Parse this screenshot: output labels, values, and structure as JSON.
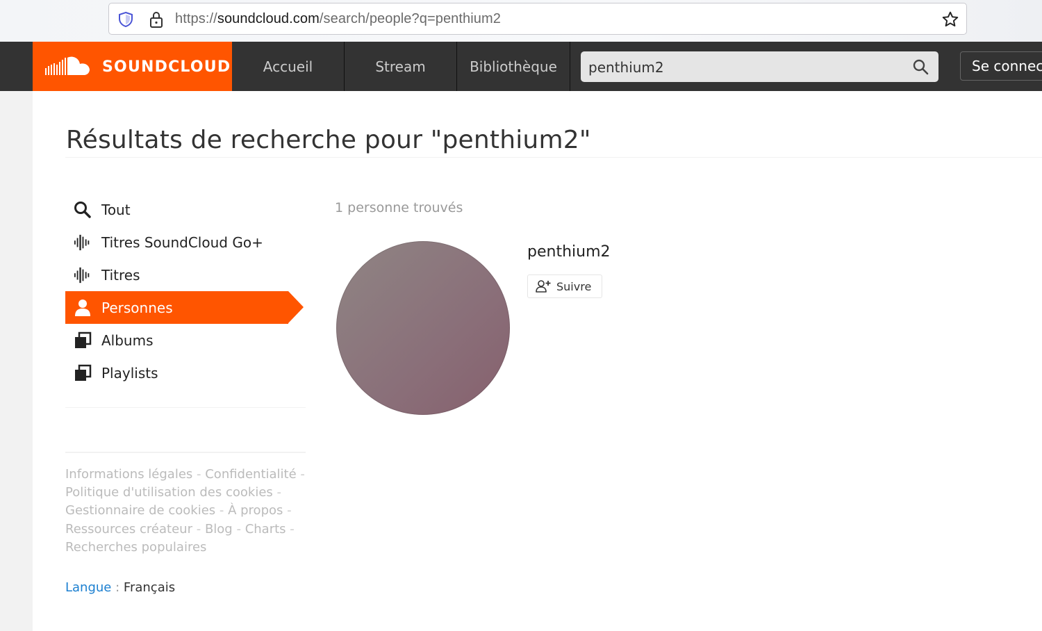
{
  "browser": {
    "url_prefix": "https://",
    "url_domain": "soundcloud.com",
    "url_path": "/search/people?q=penthium2"
  },
  "header": {
    "brand": "SOUNDCLOUD",
    "nav": [
      "Accueil",
      "Stream",
      "Bibliothèque"
    ],
    "search_value": "penthium2",
    "signin_label": "Se connecter",
    "brand_color": "#ff5500"
  },
  "page": {
    "title": "Résultats de recherche pour \"penthium2\"",
    "filters": [
      {
        "label": "Tout",
        "icon": "search-icon"
      },
      {
        "label": "Titres SoundCloud Go+",
        "icon": "waveform-icon"
      },
      {
        "label": "Titres",
        "icon": "waveform-icon"
      },
      {
        "label": "Personnes",
        "icon": "person-icon",
        "active": true
      },
      {
        "label": "Albums",
        "icon": "album-icon"
      },
      {
        "label": "Playlists",
        "icon": "playlist-icon"
      }
    ],
    "result_count": "1 personne trouvés",
    "result": {
      "username": "penthium2",
      "follow_label": "Suivre"
    },
    "footer": {
      "links": [
        "Informations légales",
        "Confidentialité",
        "Politique d'utilisation des cookies",
        "Gestionnaire de cookies",
        "À propos",
        "Ressources créateur",
        "Blog",
        "Charts",
        "Recherches populaires"
      ],
      "lang_label": "Langue",
      "lang_sep": ":",
      "lang_value": "Français"
    }
  }
}
